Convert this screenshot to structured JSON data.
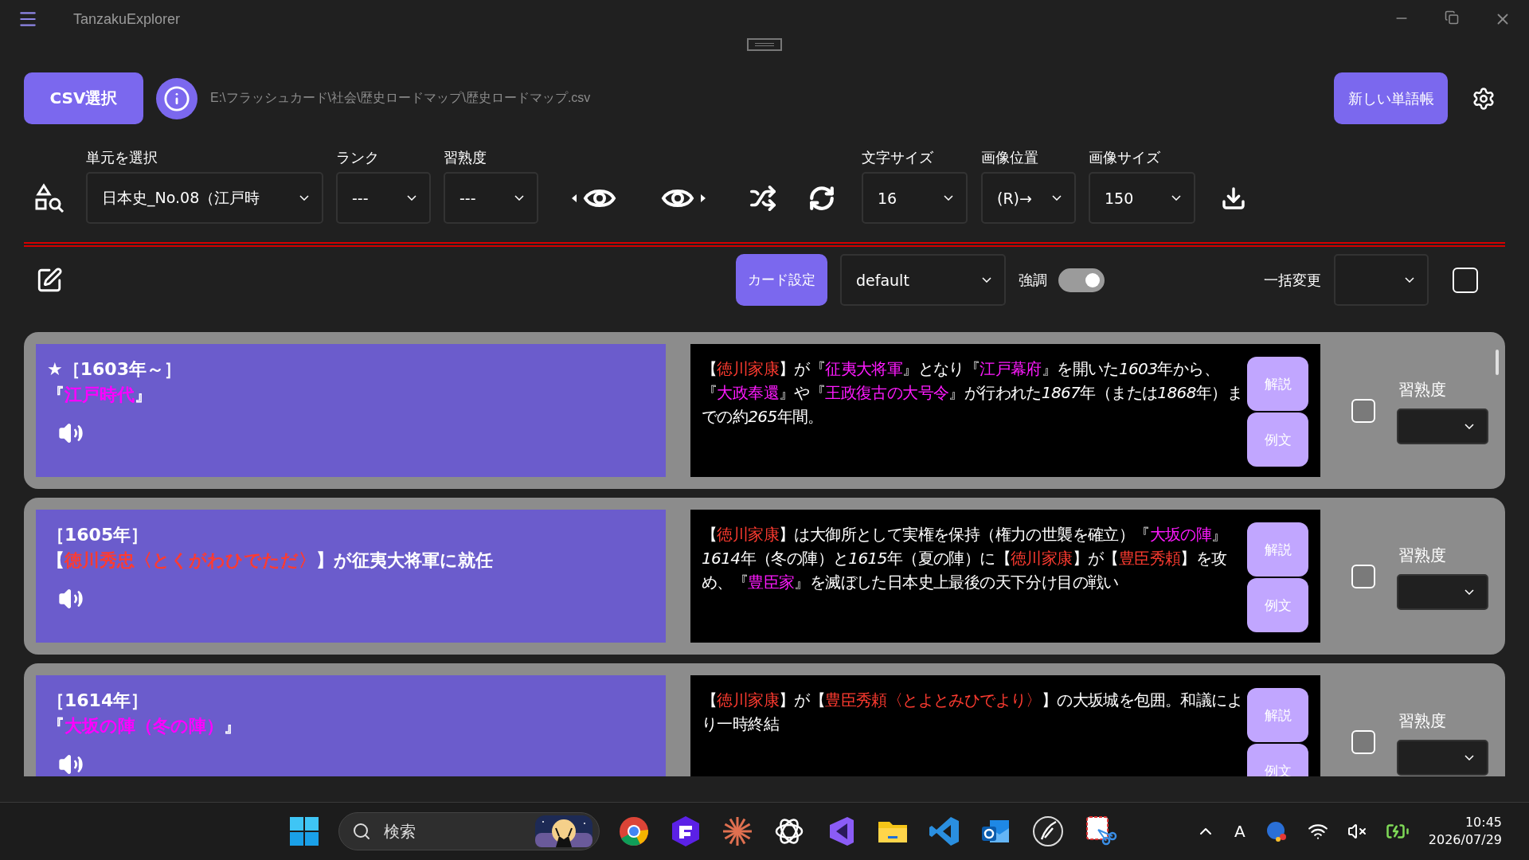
{
  "window": {
    "title": "TanzakuExplorer"
  },
  "file": {
    "button": "CSV選択",
    "path": "E:\\フラッシュカード\\社会\\歴史ロードマップ\\歴史ロードマップ.csv"
  },
  "new_button": "新しい単語帳",
  "filters": [
    {
      "label": "単元を選択",
      "value": "日本史_No.08（江戸時"
    },
    {
      "label": "ランク",
      "value": "---"
    },
    {
      "label": "習熟度",
      "value": "---"
    }
  ],
  "display": [
    {
      "label": "文字サイズ",
      "value": "16"
    },
    {
      "label": "画像位置",
      "value": "(R)→"
    },
    {
      "label": "画像サイズ",
      "value": "150"
    }
  ],
  "card_bar": {
    "settings_button": "カード設定",
    "style": "default",
    "emphasis_label": "強調",
    "emphasis_on": true,
    "bulk_label": "一括変更",
    "select_all": false
  },
  "cards": [
    {
      "front": [
        [
          {
            "kind": "plain",
            "text": "★［1603年～］"
          }
        ],
        [
          {
            "kind": "plain",
            "text": "『"
          },
          {
            "kind": "term",
            "text": "江戸時代"
          },
          {
            "kind": "plain",
            "text": "』"
          }
        ]
      ],
      "back": [
        {
          "kind": "plain",
          "text": "【"
        },
        {
          "kind": "person",
          "text": "徳川家康"
        },
        {
          "kind": "plain",
          "text": "】が『"
        },
        {
          "kind": "term",
          "text": "征夷大将軍"
        },
        {
          "kind": "plain",
          "text": "』となり『"
        },
        {
          "kind": "term",
          "text": "江戸幕府"
        },
        {
          "kind": "plain",
          "text": "』を開いた"
        },
        {
          "kind": "number",
          "text": "1603"
        },
        {
          "kind": "plain",
          "text": "年から、『"
        },
        {
          "kind": "term",
          "text": "大政奉還"
        },
        {
          "kind": "plain",
          "text": "』や『"
        },
        {
          "kind": "term",
          "text": "王政復古の大号令"
        },
        {
          "kind": "plain",
          "text": "』が行われた"
        },
        {
          "kind": "number",
          "text": "1867"
        },
        {
          "kind": "plain",
          "text": "年（または"
        },
        {
          "kind": "number",
          "text": "1868"
        },
        {
          "kind": "plain",
          "text": "年）までの約"
        },
        {
          "kind": "number",
          "text": "265"
        },
        {
          "kind": "plain",
          "text": "年間。"
        }
      ],
      "buttons": [
        "解説",
        "例文"
      ],
      "checked": false,
      "mastery_label": "習熟度"
    },
    {
      "front": [
        [
          {
            "kind": "plain",
            "text": "［1605年］"
          }
        ],
        [
          {
            "kind": "plain",
            "text": "【"
          },
          {
            "kind": "person",
            "text": "徳川秀忠〈とくがわひでただ〉"
          },
          {
            "kind": "plain",
            "text": "】が征夷大将軍に就任"
          }
        ]
      ],
      "back": [
        {
          "kind": "plain",
          "text": "【"
        },
        {
          "kind": "person",
          "text": "徳川家康"
        },
        {
          "kind": "plain",
          "text": "】は大御所として実権を保持（権力の世襲を確立）『"
        },
        {
          "kind": "term",
          "text": "大坂の陣"
        },
        {
          "kind": "plain",
          "text": "』"
        },
        {
          "kind": "number",
          "text": "1614"
        },
        {
          "kind": "plain",
          "text": "年（冬の陣）と"
        },
        {
          "kind": "number",
          "text": "1615"
        },
        {
          "kind": "plain",
          "text": "年（夏の陣）に【"
        },
        {
          "kind": "person",
          "text": "徳川家康"
        },
        {
          "kind": "plain",
          "text": "】が【"
        },
        {
          "kind": "person",
          "text": "豊臣秀頼"
        },
        {
          "kind": "plain",
          "text": "】を攻め、『"
        },
        {
          "kind": "term",
          "text": "豊臣家"
        },
        {
          "kind": "plain",
          "text": "』を滅ぼした日本史上最後の天下分け目の戦い"
        }
      ],
      "buttons": [
        "解説",
        "例文"
      ],
      "checked": false,
      "mastery_label": "習熟度"
    },
    {
      "front": [
        [
          {
            "kind": "plain",
            "text": "［1614年］"
          }
        ],
        [
          {
            "kind": "plain",
            "text": "『"
          },
          {
            "kind": "term",
            "text": "大坂の陣（冬の陣）"
          },
          {
            "kind": "plain",
            "text": "』"
          }
        ]
      ],
      "back": [
        {
          "kind": "plain",
          "text": "【"
        },
        {
          "kind": "person",
          "text": "徳川家康"
        },
        {
          "kind": "plain",
          "text": "】が【"
        },
        {
          "kind": "person",
          "text": "豊臣秀頼〈とよとみひでより〉"
        },
        {
          "kind": "plain",
          "text": "】の大坂城を包囲。和議により一時終結"
        }
      ],
      "buttons": [
        "解説",
        "例文"
      ],
      "checked": false,
      "mastery_label": "習熟度"
    }
  ],
  "taskbar": {
    "search_placeholder": "検索",
    "ime": "A",
    "time": "10:45",
    "date": "2026/07/29"
  }
}
